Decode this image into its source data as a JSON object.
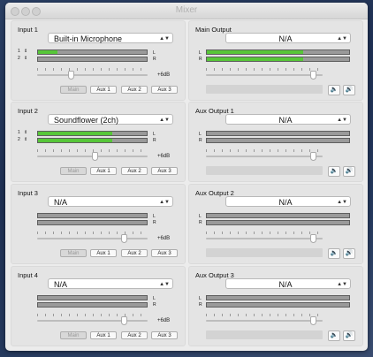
{
  "window": {
    "title": "Mixer"
  },
  "inputs": [
    {
      "label": "Input 1",
      "source": "Built-in Microphone",
      "channels": [
        "1",
        "2"
      ],
      "levels": [
        0.18,
        0.0
      ],
      "gain_label": "+6dB",
      "slider": 0.3,
      "buttons": [
        "Main",
        "Aux 1",
        "Aux 2",
        "Aux 3"
      ]
    },
    {
      "label": "Input 2",
      "source": "Soundflower (2ch)",
      "channels": [
        "1",
        "2"
      ],
      "levels": [
        0.68,
        0.68
      ],
      "gain_label": "+6dB",
      "slider": 0.52,
      "buttons": [
        "Main",
        "Aux 1",
        "Aux 2",
        "Aux 3"
      ]
    },
    {
      "label": "Input 3",
      "source": "N/A",
      "channels": [
        "",
        ""
      ],
      "levels": [
        0,
        0
      ],
      "gain_label": "+6dB",
      "slider": 0.78,
      "buttons": [
        "Main",
        "Aux 1",
        "Aux 2",
        "Aux 3"
      ]
    },
    {
      "label": "Input 4",
      "source": "N/A",
      "channels": [
        "",
        ""
      ],
      "levels": [
        0,
        0
      ],
      "gain_label": "+6dB",
      "slider": 0.78,
      "buttons": [
        "Main",
        "Aux 1",
        "Aux 2",
        "Aux 3"
      ]
    }
  ],
  "outputs": [
    {
      "label": "Main Output",
      "destination": "N/A",
      "levels": [
        0.68,
        0.68
      ],
      "slider": 0.92
    },
    {
      "label": "Aux Output 1",
      "destination": "N/A",
      "levels": [
        0,
        0
      ],
      "slider": 0.92
    },
    {
      "label": "Aux Output 2",
      "destination": "N/A",
      "levels": [
        0,
        0
      ],
      "slider": 0.92
    },
    {
      "label": "Aux Output 3",
      "destination": "N/A",
      "levels": [
        0,
        0
      ],
      "slider": 0.92
    }
  ],
  "channel_labels": {
    "left": "L",
    "right": "R"
  },
  "icons": {
    "chevron": "chevron-updown-icon",
    "mute": "speaker-mute-icon",
    "volume": "speaker-volume-icon"
  },
  "colors": {
    "meter_green": "#57c639",
    "meter_bg": "#9a9a9a"
  }
}
